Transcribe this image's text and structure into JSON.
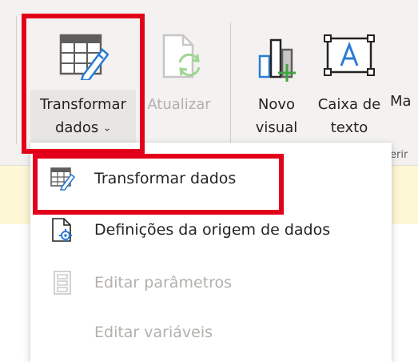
{
  "ribbon": {
    "transform_button": {
      "line1": "Transformar",
      "line2": "dados",
      "chevron": "⌄"
    },
    "refresh_button": {
      "label": "Atualizar"
    },
    "new_visual_button": {
      "line1": "Novo",
      "line2": "visual"
    },
    "textbox_button": {
      "line1": "Caixa de",
      "line2": "texto"
    },
    "more_button": {
      "label": "Ma"
    },
    "group_label_partial": "erir"
  },
  "menu": {
    "items": [
      {
        "label": "Transformar dados",
        "icon": "table-pencil-icon",
        "enabled": true
      },
      {
        "label": "Definições da origem de dados",
        "icon": "document-gear-icon",
        "enabled": true
      },
      {
        "label": "Editar parâmetros",
        "icon": "parameters-icon",
        "enabled": false
      },
      {
        "label": "Editar variáveis",
        "icon": "",
        "enabled": false
      }
    ]
  },
  "colors": {
    "highlight": "#e3001b",
    "accent_blue": "#2b7cd3",
    "refresh_green": "#6fbf5f",
    "disabled_text": "#b3b0ad",
    "notification_yellow": "#fdf7d6"
  }
}
